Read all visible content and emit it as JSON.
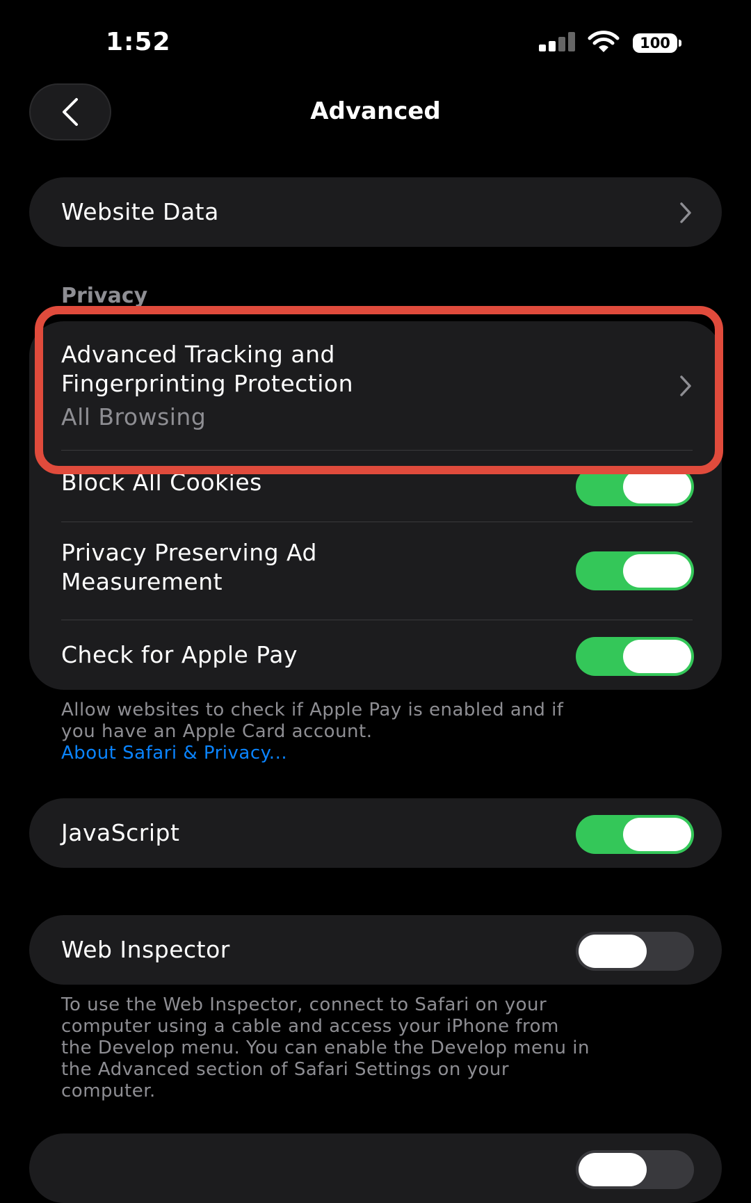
{
  "status_bar": {
    "time": "1:52",
    "battery": "100",
    "signal_icon": "cellular-signal-icon",
    "wifi_icon": "wifi-icon"
  },
  "nav": {
    "title": "Advanced",
    "back_icon": "chevron-left-icon"
  },
  "website_data": {
    "label": "Website Data"
  },
  "privacy": {
    "header": "Privacy",
    "tracking": {
      "title_line1": "Advanced Tracking and",
      "title_line2": "Fingerprinting Protection",
      "value": "All Browsing"
    },
    "block_cookies": {
      "label": "Block All Cookies",
      "enabled": true
    },
    "ad_measurement": {
      "label_line1": "Privacy Preserving Ad",
      "label_line2": "Measurement",
      "enabled": true
    },
    "apple_pay": {
      "label": "Check for Apple Pay",
      "enabled": true
    },
    "footer_line1": "Allow websites to check if Apple Pay is enabled and if",
    "footer_line2": "you have an Apple Card account.",
    "footer_link": "About Safari & Privacy..."
  },
  "javascript": {
    "label": "JavaScript",
    "enabled": true
  },
  "web_inspector": {
    "label": "Web Inspector",
    "enabled": false,
    "footer_lines": [
      "To use the Web Inspector, connect to Safari on your",
      "computer using a cable and access your iPhone from",
      "the Develop menu. You can enable the Develop menu in",
      "the Advanced section of Safari Settings on your",
      "computer."
    ]
  },
  "colors": {
    "background": "#000000",
    "cell": "#1c1c1e",
    "toggle_on": "#34c759",
    "link": "#0a84ff",
    "highlight": "#e04b3c"
  }
}
